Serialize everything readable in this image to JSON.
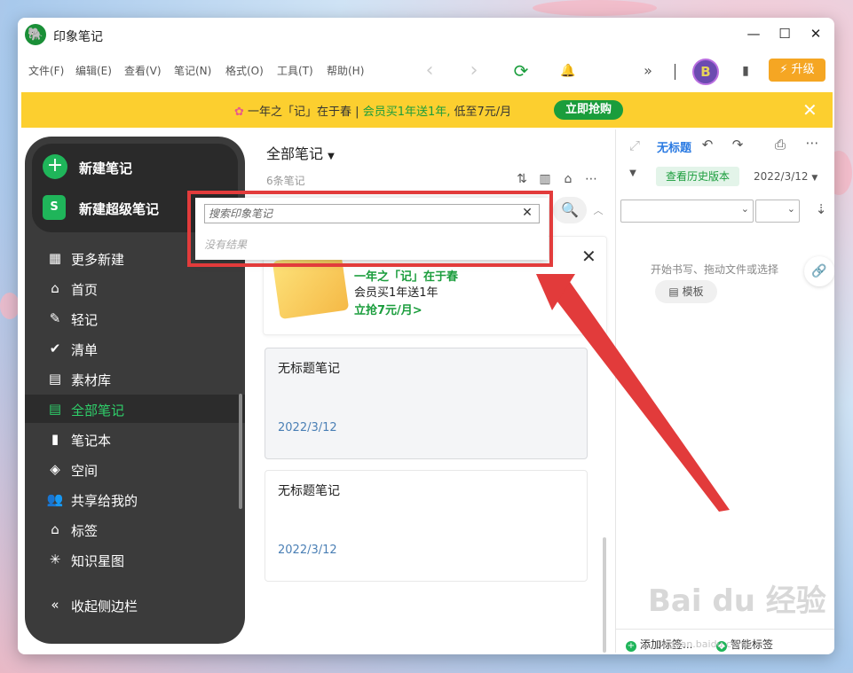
{
  "window": {
    "title": "印象笔记",
    "controls": {
      "minimize": "—",
      "maximize": "☐",
      "close": "✕"
    }
  },
  "menu": [
    "文件(F)",
    "编辑(E)",
    "查看(V)",
    "笔记(N)",
    "格式(O)",
    "工具(T)",
    "帮助(H)"
  ],
  "toolbar": {
    "back": "‹",
    "forward": "›",
    "sync": "⟳",
    "bell": "🔔",
    "more": "»",
    "avatar_letter": "B",
    "upgrade_label": "升级"
  },
  "banner": {
    "part1": "一年之「记」在于春 | ",
    "part2": "会员买1年送1年,",
    "part3": " 低至7元/月",
    "button": "立即抢购",
    "close": "✕"
  },
  "sidebar": {
    "new_note": "新建笔记",
    "new_super_note": "新建超级笔记",
    "items": [
      {
        "label": "更多新建",
        "icon": "▦"
      },
      {
        "label": "首页",
        "icon": "⌂"
      },
      {
        "label": "轻记",
        "icon": "✎"
      },
      {
        "label": "清单",
        "icon": "✔"
      },
      {
        "label": "素材库",
        "icon": "▤"
      },
      {
        "label": "全部笔记",
        "icon": "▤"
      },
      {
        "label": "笔记本",
        "icon": "▮"
      },
      {
        "label": "空间",
        "icon": "◈"
      },
      {
        "label": "共享给我的",
        "icon": "👥"
      },
      {
        "label": "标签",
        "icon": "⌂"
      },
      {
        "label": "知识星图",
        "icon": "✳"
      }
    ],
    "collapse": "收起侧边栏",
    "collapse_icon": "«"
  },
  "note_list": {
    "title": "全部笔记",
    "count": "6条笔记",
    "promo": {
      "line1": "一年之「记」在于春",
      "line2": "会员买1年送1年",
      "line3": "立抢7元/月>"
    },
    "notes": [
      {
        "title": "无标题笔记",
        "date": "2022/3/12"
      },
      {
        "title": "无标题笔记",
        "date": "2022/3/12"
      }
    ]
  },
  "search": {
    "placeholder": "搜索印象笔记",
    "no_results": "没有结果",
    "clear": "✕"
  },
  "editor": {
    "title": "无标题",
    "history_button": "查看历史版本",
    "date": "2022/3/12",
    "placeholder": "开始书写、拖动文件或选择",
    "template_button": "模板",
    "add_tag": "添加标签...",
    "smart_tag": "智能标签"
  },
  "watermark": {
    "main": "Bai du 经验",
    "sub": "jingyan.baidu.com"
  },
  "colors": {
    "accent": "#1a9d3c",
    "banner": "#fccf2f",
    "upgrade": "#f5a623",
    "highlight": "#e23b3b"
  }
}
